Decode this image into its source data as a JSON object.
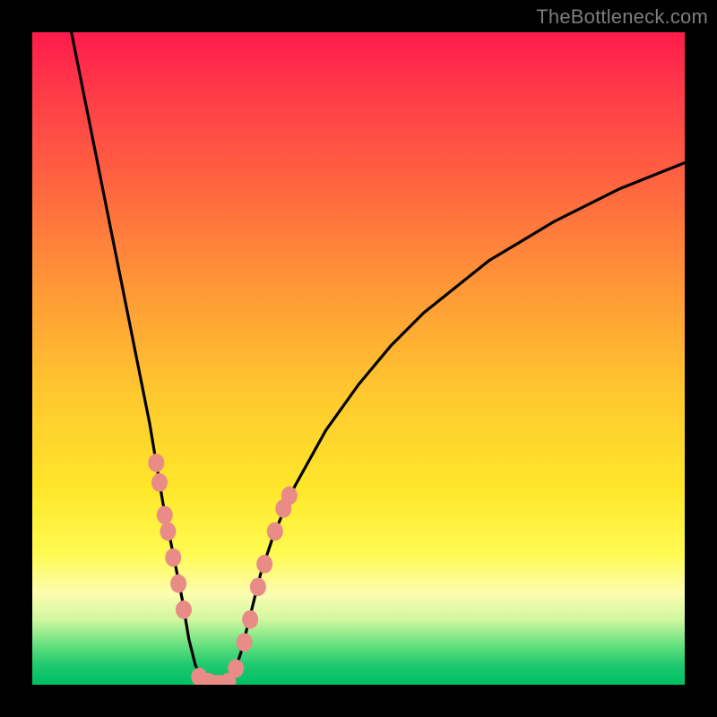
{
  "watermark": "TheBottleneck.com",
  "chart_data": {
    "type": "line",
    "title": "",
    "xlabel": "",
    "ylabel": "",
    "xlim": [
      0,
      100
    ],
    "ylim": [
      0,
      100
    ],
    "curve_left": {
      "name": "bottleneck-curve-left",
      "x": [
        6,
        8,
        10,
        12,
        14,
        16,
        18,
        19,
        20,
        21,
        22,
        23,
        23.5,
        24,
        24.5,
        25,
        26,
        27
      ],
      "y": [
        100,
        90,
        80,
        70,
        60,
        50,
        40,
        34,
        28,
        23,
        18,
        13,
        10,
        7,
        5,
        3,
        1,
        0
      ]
    },
    "curve_right": {
      "name": "bottleneck-curve-right",
      "x": [
        30,
        31,
        32,
        33,
        34,
        35,
        37,
        40,
        45,
        50,
        55,
        60,
        65,
        70,
        75,
        80,
        85,
        90,
        95,
        100
      ],
      "y": [
        0,
        2,
        5,
        9,
        13,
        17,
        23,
        30,
        39,
        46,
        52,
        57,
        61,
        65,
        68,
        71,
        73.5,
        76,
        78,
        80
      ]
    },
    "markers_left": {
      "name": "left-branch-dots",
      "color": "#e98b86",
      "points": [
        {
          "x": 19.0,
          "y": 34
        },
        {
          "x": 19.5,
          "y": 31
        },
        {
          "x": 20.3,
          "y": 26
        },
        {
          "x": 20.8,
          "y": 23.5
        },
        {
          "x": 21.6,
          "y": 19.5
        },
        {
          "x": 22.4,
          "y": 15.5
        },
        {
          "x": 23.2,
          "y": 11.5
        },
        {
          "x": 25.6,
          "y": 1.2
        },
        {
          "x": 27.0,
          "y": 0.4
        }
      ]
    },
    "markers_right": {
      "name": "right-branch-dots",
      "color": "#e98b86",
      "points": [
        {
          "x": 30.0,
          "y": 0.4
        },
        {
          "x": 31.2,
          "y": 2.5
        },
        {
          "x": 32.5,
          "y": 6.5
        },
        {
          "x": 33.4,
          "y": 10.0
        },
        {
          "x": 34.6,
          "y": 15.0
        },
        {
          "x": 35.6,
          "y": 18.5
        },
        {
          "x": 37.2,
          "y": 23.5
        },
        {
          "x": 38.5,
          "y": 27.0
        },
        {
          "x": 39.4,
          "y": 29.0
        }
      ]
    },
    "plateau": {
      "name": "valley-plateau",
      "color": "#e98b86",
      "xStart": 25.8,
      "xEnd": 30.0,
      "y": 0.4,
      "thickness": 2.2
    }
  }
}
